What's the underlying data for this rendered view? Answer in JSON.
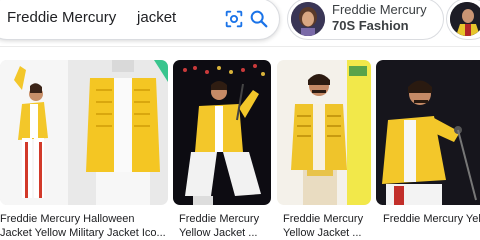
{
  "search": {
    "query": "Freddie Mercury     jacket",
    "lens_icon": "camera-lens-icon",
    "search_icon": "magnifier-icon"
  },
  "chips": [
    {
      "line1": "Freddie Mercury",
      "line2": "70S Fashion"
    }
  ],
  "results": [
    {
      "title_line1": "Freddie Mercury Halloween",
      "title_line2": "Jacket Yellow Military Jacket Ico..."
    },
    {
      "title_line1": "Freddie Mercury",
      "title_line2": "Yellow Jacket ..."
    },
    {
      "title_line1": "Freddie Mercury",
      "title_line2": "Yellow Jacket ..."
    },
    {
      "title_line1": "Freddie Mercury Yell",
      "title_line2": ""
    }
  ],
  "colors": {
    "jacket_yellow": "#f3c72a",
    "text": "#202124",
    "border": "#dadce0",
    "icon_blue": "#1a73e8"
  }
}
